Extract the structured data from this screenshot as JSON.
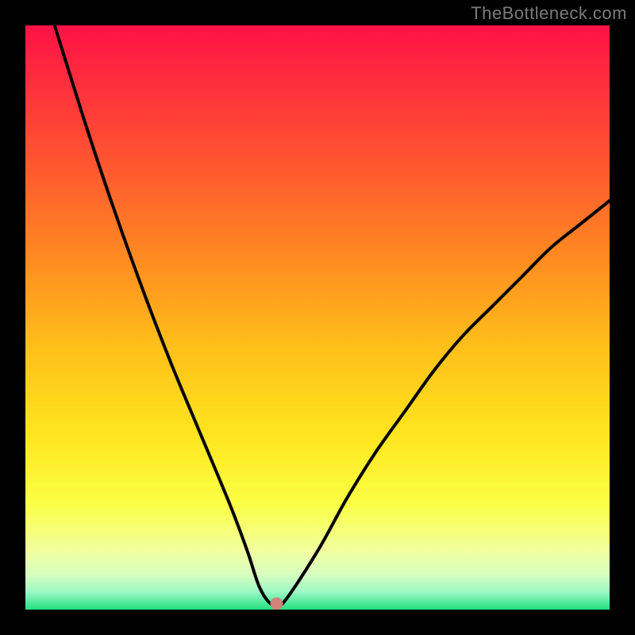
{
  "watermark": "TheBottleneck.com",
  "colors": {
    "marker": "#cf8379",
    "curve": "#000000",
    "frame": "#000000"
  },
  "chart_data": {
    "type": "line",
    "title": "",
    "xlabel": "",
    "ylabel": "",
    "xlim": [
      0,
      100
    ],
    "ylim": [
      0,
      100
    ],
    "description": "Bottleneck percentage curve. Y is bottleneck (0 green = balanced, 100 red = severe). Curve dips to ~0 near x≈42 and rises on both sides.",
    "series": [
      {
        "name": "bottleneck",
        "x": [
          0,
          5,
          10,
          15,
          20,
          25,
          30,
          35,
          38,
          40,
          42,
          44,
          50,
          55,
          60,
          65,
          70,
          75,
          80,
          85,
          90,
          95,
          100
        ],
        "values": [
          116,
          100,
          84,
          69,
          55,
          42,
          30,
          18,
          10,
          4,
          1,
          1,
          10,
          19,
          27,
          34,
          41,
          47,
          52,
          57,
          62,
          66,
          70
        ]
      }
    ],
    "marker": {
      "x": 43,
      "y": 1
    }
  }
}
